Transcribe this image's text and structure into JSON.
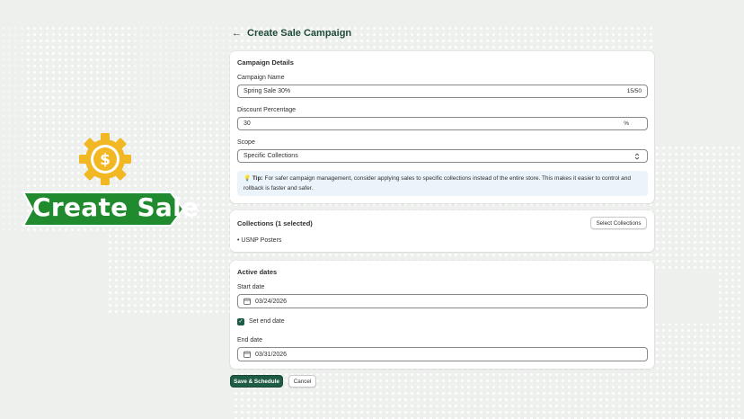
{
  "promo": {
    "banner_text": "Create Sale",
    "gear_icon": "gear-dollar-icon",
    "colors": {
      "gear": "#f2b824",
      "banner": "#1f8a2e",
      "banner_border": "#ffffff"
    }
  },
  "header": {
    "back_icon": "arrow-left-icon",
    "title": "Create Sale Campaign"
  },
  "campaign_details": {
    "title": "Campaign Details",
    "name_label": "Campaign Name",
    "name_value": "Spring Sale 30%",
    "name_counter": "15/50",
    "discount_label": "Discount Percentage",
    "discount_value": "30",
    "discount_suffix": "%",
    "scope_label": "Scope",
    "scope_value": "Specific Collections",
    "tip_icon": "lightbulb-icon",
    "tip_label": "Tip:",
    "tip_text": "For safer campaign management, consider applying sales to specific collections instead of the entire store. This makes it easier to control and rollback is faster and safer."
  },
  "collections": {
    "title": "Collections (1 selected)",
    "select_button": "Select Collections",
    "items": [
      "USNP Posters"
    ]
  },
  "active_dates": {
    "title": "Active dates",
    "start_label": "Start date",
    "start_value": "03/24/2026",
    "end_checkbox_label": "Set end date",
    "end_checked": true,
    "end_label": "End date",
    "end_value": "03/31/2026"
  },
  "actions": {
    "save": "Save & Schedule",
    "cancel": "Cancel"
  },
  "colors": {
    "primary": "#1f5c45",
    "title": "#1f4a3a",
    "tip_bg": "#eaf4fa",
    "background": "#eef0ee"
  }
}
